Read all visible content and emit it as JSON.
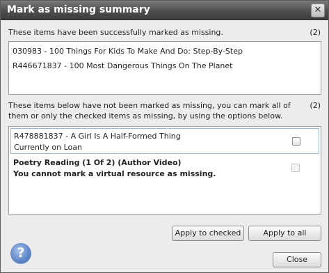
{
  "dialog": {
    "title": "Mark as missing summary",
    "close_glyph": "✕"
  },
  "marked": {
    "label": "These items have been successfully marked as missing.",
    "count": "(2)",
    "items": [
      "030983 - 100 Things For Kids To Make And Do: Step-By-Step",
      "R446671837 - 100 Most Dangerous Things On The Planet"
    ]
  },
  "unmarked": {
    "label_line1": "These items below have not been marked as missing, you can mark all of",
    "label_line2": "them or only the checked items as missing, by using the options below.",
    "count": "(2)",
    "items": [
      {
        "title": "R478881837 - A Girl Is A Half-Formed Thing",
        "status": "Currently on Loan",
        "checked": false,
        "disabled": false
      },
      {
        "title": "Poetry Reading (1 Of 2) (Author Video)",
        "status": "You cannot mark a virtual resource as missing.",
        "checked": false,
        "disabled": true
      }
    ]
  },
  "buttons": {
    "apply_checked": "Apply to checked",
    "apply_all": "Apply to all",
    "close": "Close"
  },
  "help": {
    "glyph": "?",
    "icon": "help-question-icon"
  },
  "colors": {
    "title_bar": "#4e4e4e",
    "dialog_bg": "#ececec",
    "selection_border": "#9fb9cc",
    "help_blue": "#5e86c8"
  }
}
